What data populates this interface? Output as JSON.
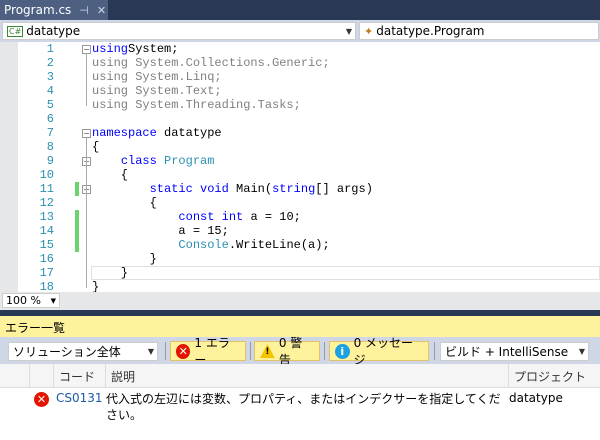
{
  "tab": {
    "title": "Program.cs",
    "pin_icon": "pin-icon",
    "close_icon": "close-icon"
  },
  "nav": {
    "project": "datatype",
    "project_icon": "csharp-icon",
    "class": "datatype.Program",
    "class_icon": "class-icon"
  },
  "editor": {
    "lines": [
      [
        [
          "kw",
          "using"
        ],
        [
          "",
          "System;"
        ]
      ],
      [
        [
          "gr",
          "using System.Collections.Generic;"
        ]
      ],
      [
        [
          "gr",
          "using System.Linq;"
        ]
      ],
      [
        [
          "gr",
          "using System.Text;"
        ]
      ],
      [
        [
          "gr",
          "using System.Threading.Tasks;"
        ]
      ],
      [],
      [
        [
          "kw",
          "namespace"
        ],
        [
          "",
          " datatype"
        ]
      ],
      [
        [
          "",
          "{"
        ]
      ],
      [
        [
          "",
          "    "
        ],
        [
          "kw",
          "class"
        ],
        [
          "",
          " "
        ],
        [
          "ty",
          "Program"
        ]
      ],
      [
        [
          "",
          "    {"
        ]
      ],
      [
        [
          "",
          "        "
        ],
        [
          "kw",
          "static"
        ],
        [
          "",
          " "
        ],
        [
          "kw",
          "void"
        ],
        [
          "",
          " Main("
        ],
        [
          "kw",
          "string"
        ],
        [
          "",
          "[] args)"
        ]
      ],
      [
        [
          "",
          "        {"
        ]
      ],
      [
        [
          "",
          "            "
        ],
        [
          "kw",
          "const"
        ],
        [
          "",
          " "
        ],
        [
          "kw",
          "int"
        ],
        [
          "",
          " a = 10;"
        ]
      ],
      [
        [
          "",
          "            a = 15;"
        ]
      ],
      [
        [
          "",
          "            "
        ],
        [
          "ty",
          "Console"
        ],
        [
          "",
          ".WriteLine(a);"
        ]
      ],
      [
        [
          "",
          "        }"
        ]
      ],
      [
        [
          "",
          "    }"
        ]
      ],
      [
        [
          "",
          "}"
        ]
      ]
    ],
    "changed_lines": [
      11,
      13,
      14,
      15
    ],
    "current_line": 14,
    "zoom": "100 %"
  },
  "error_list": {
    "title": "エラー一覧",
    "scope": "ソリューション全体",
    "errors_filter": "1 エラー",
    "warnings_filter": "0 警告",
    "messages_filter": "0 メッセージ",
    "source": "ビルド + IntelliSense",
    "columns": {
      "code": "コード",
      "description": "説明",
      "project": "プロジェクト"
    },
    "rows": [
      {
        "code": "CS0131",
        "description": "代入式の左辺には変数、プロパティ、またはインデクサーを指定してください。",
        "project": "datatype",
        "severity": "error"
      }
    ],
    "colors": {
      "error": "#e51400",
      "warning": "#f5c400",
      "info": "#1ba1e2",
      "link": "#1e5aa8"
    }
  }
}
